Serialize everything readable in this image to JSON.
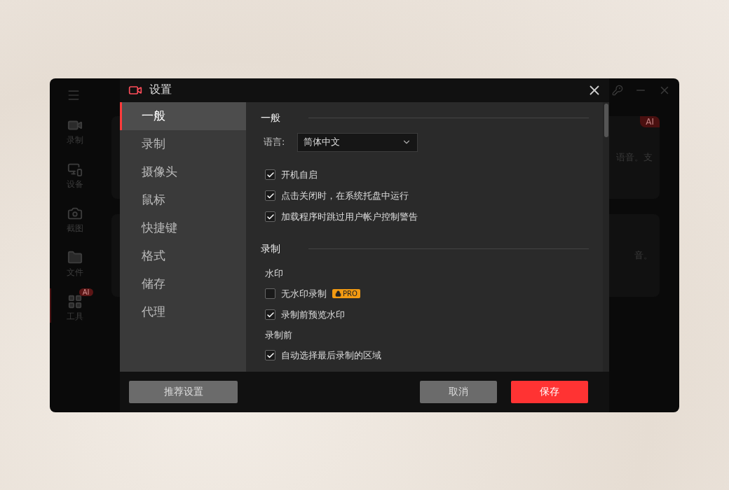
{
  "background_app": {
    "sidebar": [
      {
        "label": "录制",
        "kind": "camera",
        "selected": false
      },
      {
        "label": "设备",
        "kind": "devices",
        "selected": false
      },
      {
        "label": "截图",
        "kind": "snapshot",
        "selected": false
      },
      {
        "label": "文件",
        "kind": "folder",
        "selected": false
      },
      {
        "label": "工具",
        "kind": "tools",
        "selected": true,
        "badge": "AI"
      }
    ],
    "cards": [
      {
        "text": "语音。支",
        "badge": "AI"
      },
      {
        "text": "音。"
      }
    ]
  },
  "dialog": {
    "title": "设置",
    "nav": [
      {
        "label": "一般",
        "selected": true
      },
      {
        "label": "录制",
        "selected": false
      },
      {
        "label": "摄像头",
        "selected": false
      },
      {
        "label": "鼠标",
        "selected": false
      },
      {
        "label": "快捷键",
        "selected": false
      },
      {
        "label": "格式",
        "selected": false
      },
      {
        "label": "储存",
        "selected": false
      },
      {
        "label": "代理",
        "selected": false
      }
    ],
    "general": {
      "title": "一般",
      "language_label": "语言:",
      "language_value": "简体中文",
      "options": [
        {
          "label": "开机自启",
          "checked": true
        },
        {
          "label": "点击关闭时，在系统托盘中运行",
          "checked": true
        },
        {
          "label": "加载程序时跳过用户帐户控制警告",
          "checked": true
        }
      ]
    },
    "recording": {
      "title": "录制",
      "groups": [
        {
          "title": "水印",
          "options": [
            {
              "label": "无水印录制",
              "checked": false,
              "badge": "PRO"
            },
            {
              "label": "录制前预览水印",
              "checked": true
            }
          ]
        },
        {
          "title": "录制前",
          "options": [
            {
              "label": "自动选择最后录制的区域",
              "checked": true
            }
          ]
        }
      ]
    },
    "buttons": {
      "recommend": "推荐设置",
      "cancel": "取消",
      "save": "保存"
    }
  }
}
